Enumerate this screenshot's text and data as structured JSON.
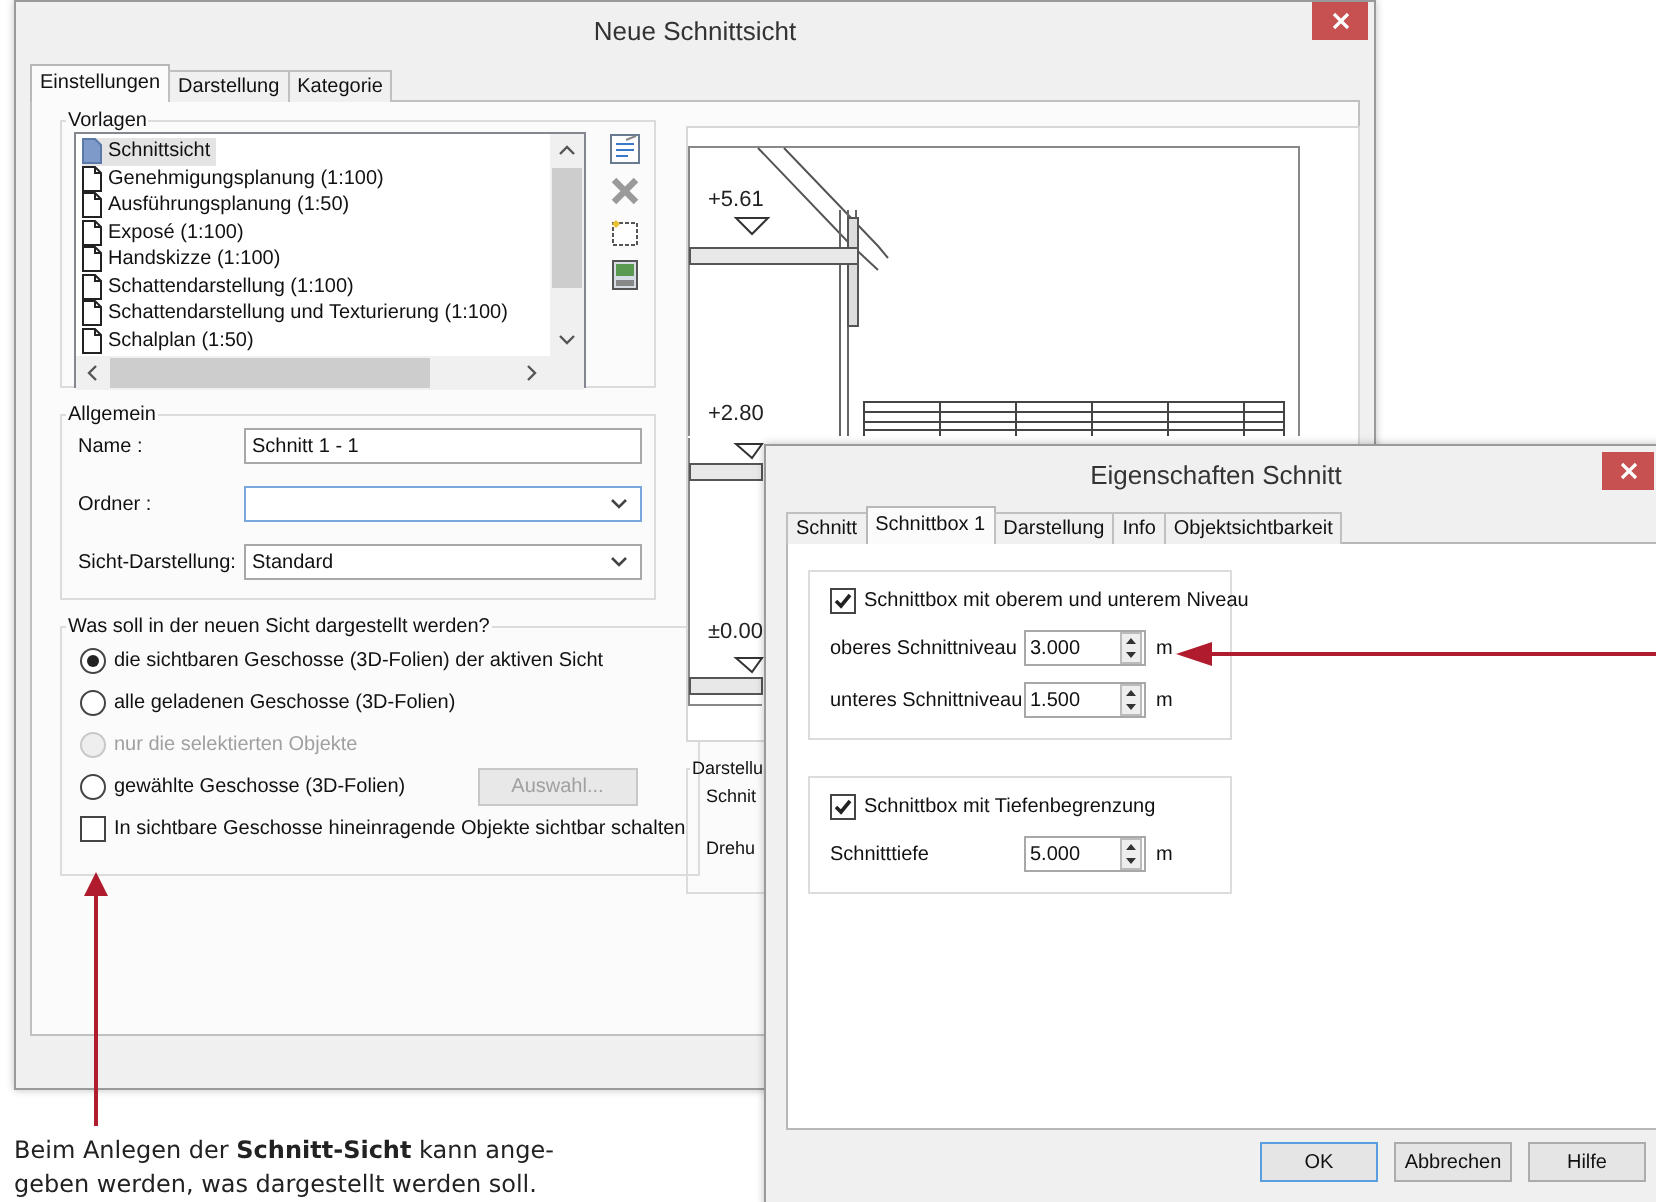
{
  "main_dialog": {
    "title": "Neue Schnittsicht",
    "tabs": [
      {
        "label": "Einstellungen",
        "selected": true
      },
      {
        "label": "Darstellung",
        "selected": false
      },
      {
        "label": "Kategorie",
        "selected": false
      }
    ],
    "templates": {
      "label": "Vorlagen",
      "items": [
        {
          "label": "Schnittsicht",
          "selected": true
        },
        {
          "label": "Genehmigungsplanung (1:100)",
          "selected": false
        },
        {
          "label": "Ausführungsplanung (1:50)",
          "selected": false
        },
        {
          "label": "Exposé (1:100)",
          "selected": false
        },
        {
          "label": "Handskizze (1:100)",
          "selected": false
        },
        {
          "label": "Schattendarstellung (1:100)",
          "selected": false
        },
        {
          "label": "Schattendarstellung und Texturierung (1:100)",
          "selected": false
        },
        {
          "label": "Schalplan (1:50)",
          "selected": false
        }
      ]
    },
    "general": {
      "label": "Allgemein",
      "fields": [
        {
          "kind": "text",
          "label": "Name :",
          "value": "Schnitt 1 - 1",
          "focused": false
        },
        {
          "kind": "select",
          "label": "Ordner :",
          "focused": true
        },
        {
          "kind": "select",
          "label": "Sicht-Darstellung:",
          "value": "Standard",
          "focused": false
        }
      ]
    },
    "content": {
      "label": "Was soll in der neuen Sicht dargestellt werden?",
      "options": [
        {
          "kind": "radio",
          "label": "die sichtbaren Geschosse (3D-Folien) der aktiven Sicht",
          "selected": true,
          "disabled": false
        },
        {
          "kind": "radio",
          "label": "alle geladenen Geschosse (3D-Folien)",
          "selected": false,
          "disabled": false
        },
        {
          "kind": "radio",
          "label": "nur die selektierten Objekte",
          "selected": false,
          "disabled": true
        },
        {
          "kind": "radio",
          "label": "gewählte Geschosse (3D-Folien)",
          "selected": false,
          "disabled": false,
          "button": {
            "label": "Auswahl...",
            "disabled": true
          }
        },
        {
          "kind": "checkbox",
          "label": "In sichtbare Geschosse hineinragende Objekte sichtbar schalten",
          "checked": false
        }
      ]
    },
    "preview": {
      "levels": [
        "+5.61",
        "+2.80",
        "±0.00"
      ]
    },
    "display": {
      "label": "Darstellu",
      "rows": [
        "Schnit",
        "Drehu"
      ]
    }
  },
  "properties_dialog": {
    "title": "Eigenschaften Schnitt",
    "tabs": [
      {
        "label": "Schnitt",
        "selected": false
      },
      {
        "label": "Schnittbox 1",
        "selected": true
      },
      {
        "label": "Darstellung",
        "selected": false
      },
      {
        "label": "Info",
        "selected": false
      },
      {
        "label": "Objektsichtbarkeit",
        "selected": false
      }
    ],
    "groups": [
      {
        "label": "Schnittbox mit oberem und unterem Niveau",
        "checked": true,
        "fields": [
          {
            "label": "oberes Schnittniveau",
            "value": "3.000",
            "unit": "m"
          },
          {
            "label": "unteres Schnittniveau",
            "value": "1.500",
            "unit": "m"
          }
        ]
      },
      {
        "label": "Schnittbox mit Tiefenbegrenzung",
        "checked": true,
        "fields": [
          {
            "label": "Schnitttiefe",
            "value": "5.000",
            "unit": "m"
          }
        ]
      }
    ],
    "buttons": [
      {
        "label": "OK",
        "default": true
      },
      {
        "label": "Abbrechen",
        "default": false
      },
      {
        "label": "Hilfe",
        "default": false
      }
    ]
  },
  "caption": {
    "text": "Beim Anlegen der **Schnitt-Sicht** kann ange-\ngeben werden, was dargestellt werden soll."
  }
}
